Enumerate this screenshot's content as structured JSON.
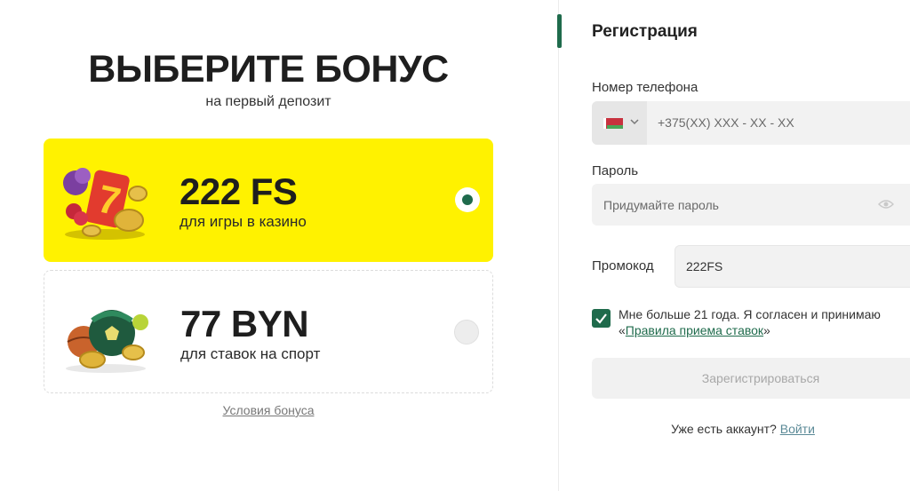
{
  "bonus": {
    "title": "ВЫБЕРИТЕ БОНУС",
    "subtitle": "на первый депозит",
    "options": [
      {
        "amount": "222 FS",
        "description": "для игры в казино",
        "selected": true,
        "art_icon": "slot-machine-icon"
      },
      {
        "amount": "77 BYN",
        "description": "для ставок на спорт",
        "selected": false,
        "art_icon": "sports-balls-icon"
      }
    ],
    "terms_link": "Условия бонуса"
  },
  "registration": {
    "title": "Регистрация",
    "phone_label": "Номер телефона",
    "phone_placeholder": "+375(XX) XXX - XX - XX",
    "country_flag": "belarus-flag-icon",
    "password_label": "Пароль",
    "password_placeholder": "Придумайте пароль",
    "promo_label": "Промокод",
    "promo_value": "222FS",
    "agree_checked": true,
    "agree_text": "Мне больше 21 года. Я согласен и принимаю ",
    "agree_quote_open": "«",
    "agree_link": "Правила приема ставок",
    "agree_quote_close": "»",
    "submit_label": "Зарегистрироваться",
    "login_prompt": "Уже есть аккаунт? ",
    "login_link": "Войти"
  },
  "colors": {
    "accent": "#1f6b4c",
    "selected_card": "#fff200",
    "field_bg": "#f2f2f2"
  }
}
